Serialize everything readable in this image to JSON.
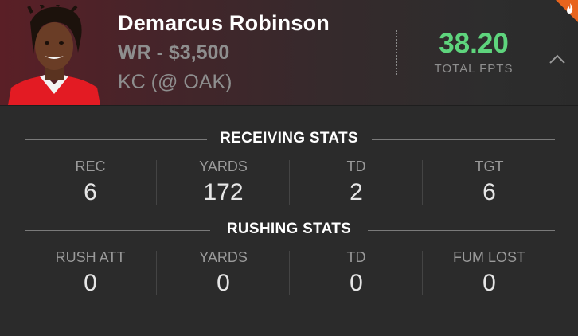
{
  "player": {
    "name": "Demarcus Robinson",
    "position_salary": "WR - $3,500",
    "matchup": "KC (@ OAK)",
    "fpts": "38.20",
    "fpts_label": "TOTAL FPTS"
  },
  "colors": {
    "fpts_green": "#5ed47d",
    "header_red": "#5a1f26",
    "badge_orange": "#e8641d"
  },
  "icons": {
    "collapse": "chevron-up-icon",
    "hot": "flame-icon"
  },
  "receiving": {
    "title": "RECEIVING STATS",
    "stats": [
      {
        "label": "REC",
        "value": "6"
      },
      {
        "label": "YARDS",
        "value": "172"
      },
      {
        "label": "TD",
        "value": "2"
      },
      {
        "label": "TGT",
        "value": "6"
      }
    ]
  },
  "rushing": {
    "title": "RUSHING STATS",
    "stats": [
      {
        "label": "RUSH ATT",
        "value": "0"
      },
      {
        "label": "YARDS",
        "value": "0"
      },
      {
        "label": "TD",
        "value": "0"
      },
      {
        "label": "FUM LOST",
        "value": "0"
      }
    ]
  }
}
